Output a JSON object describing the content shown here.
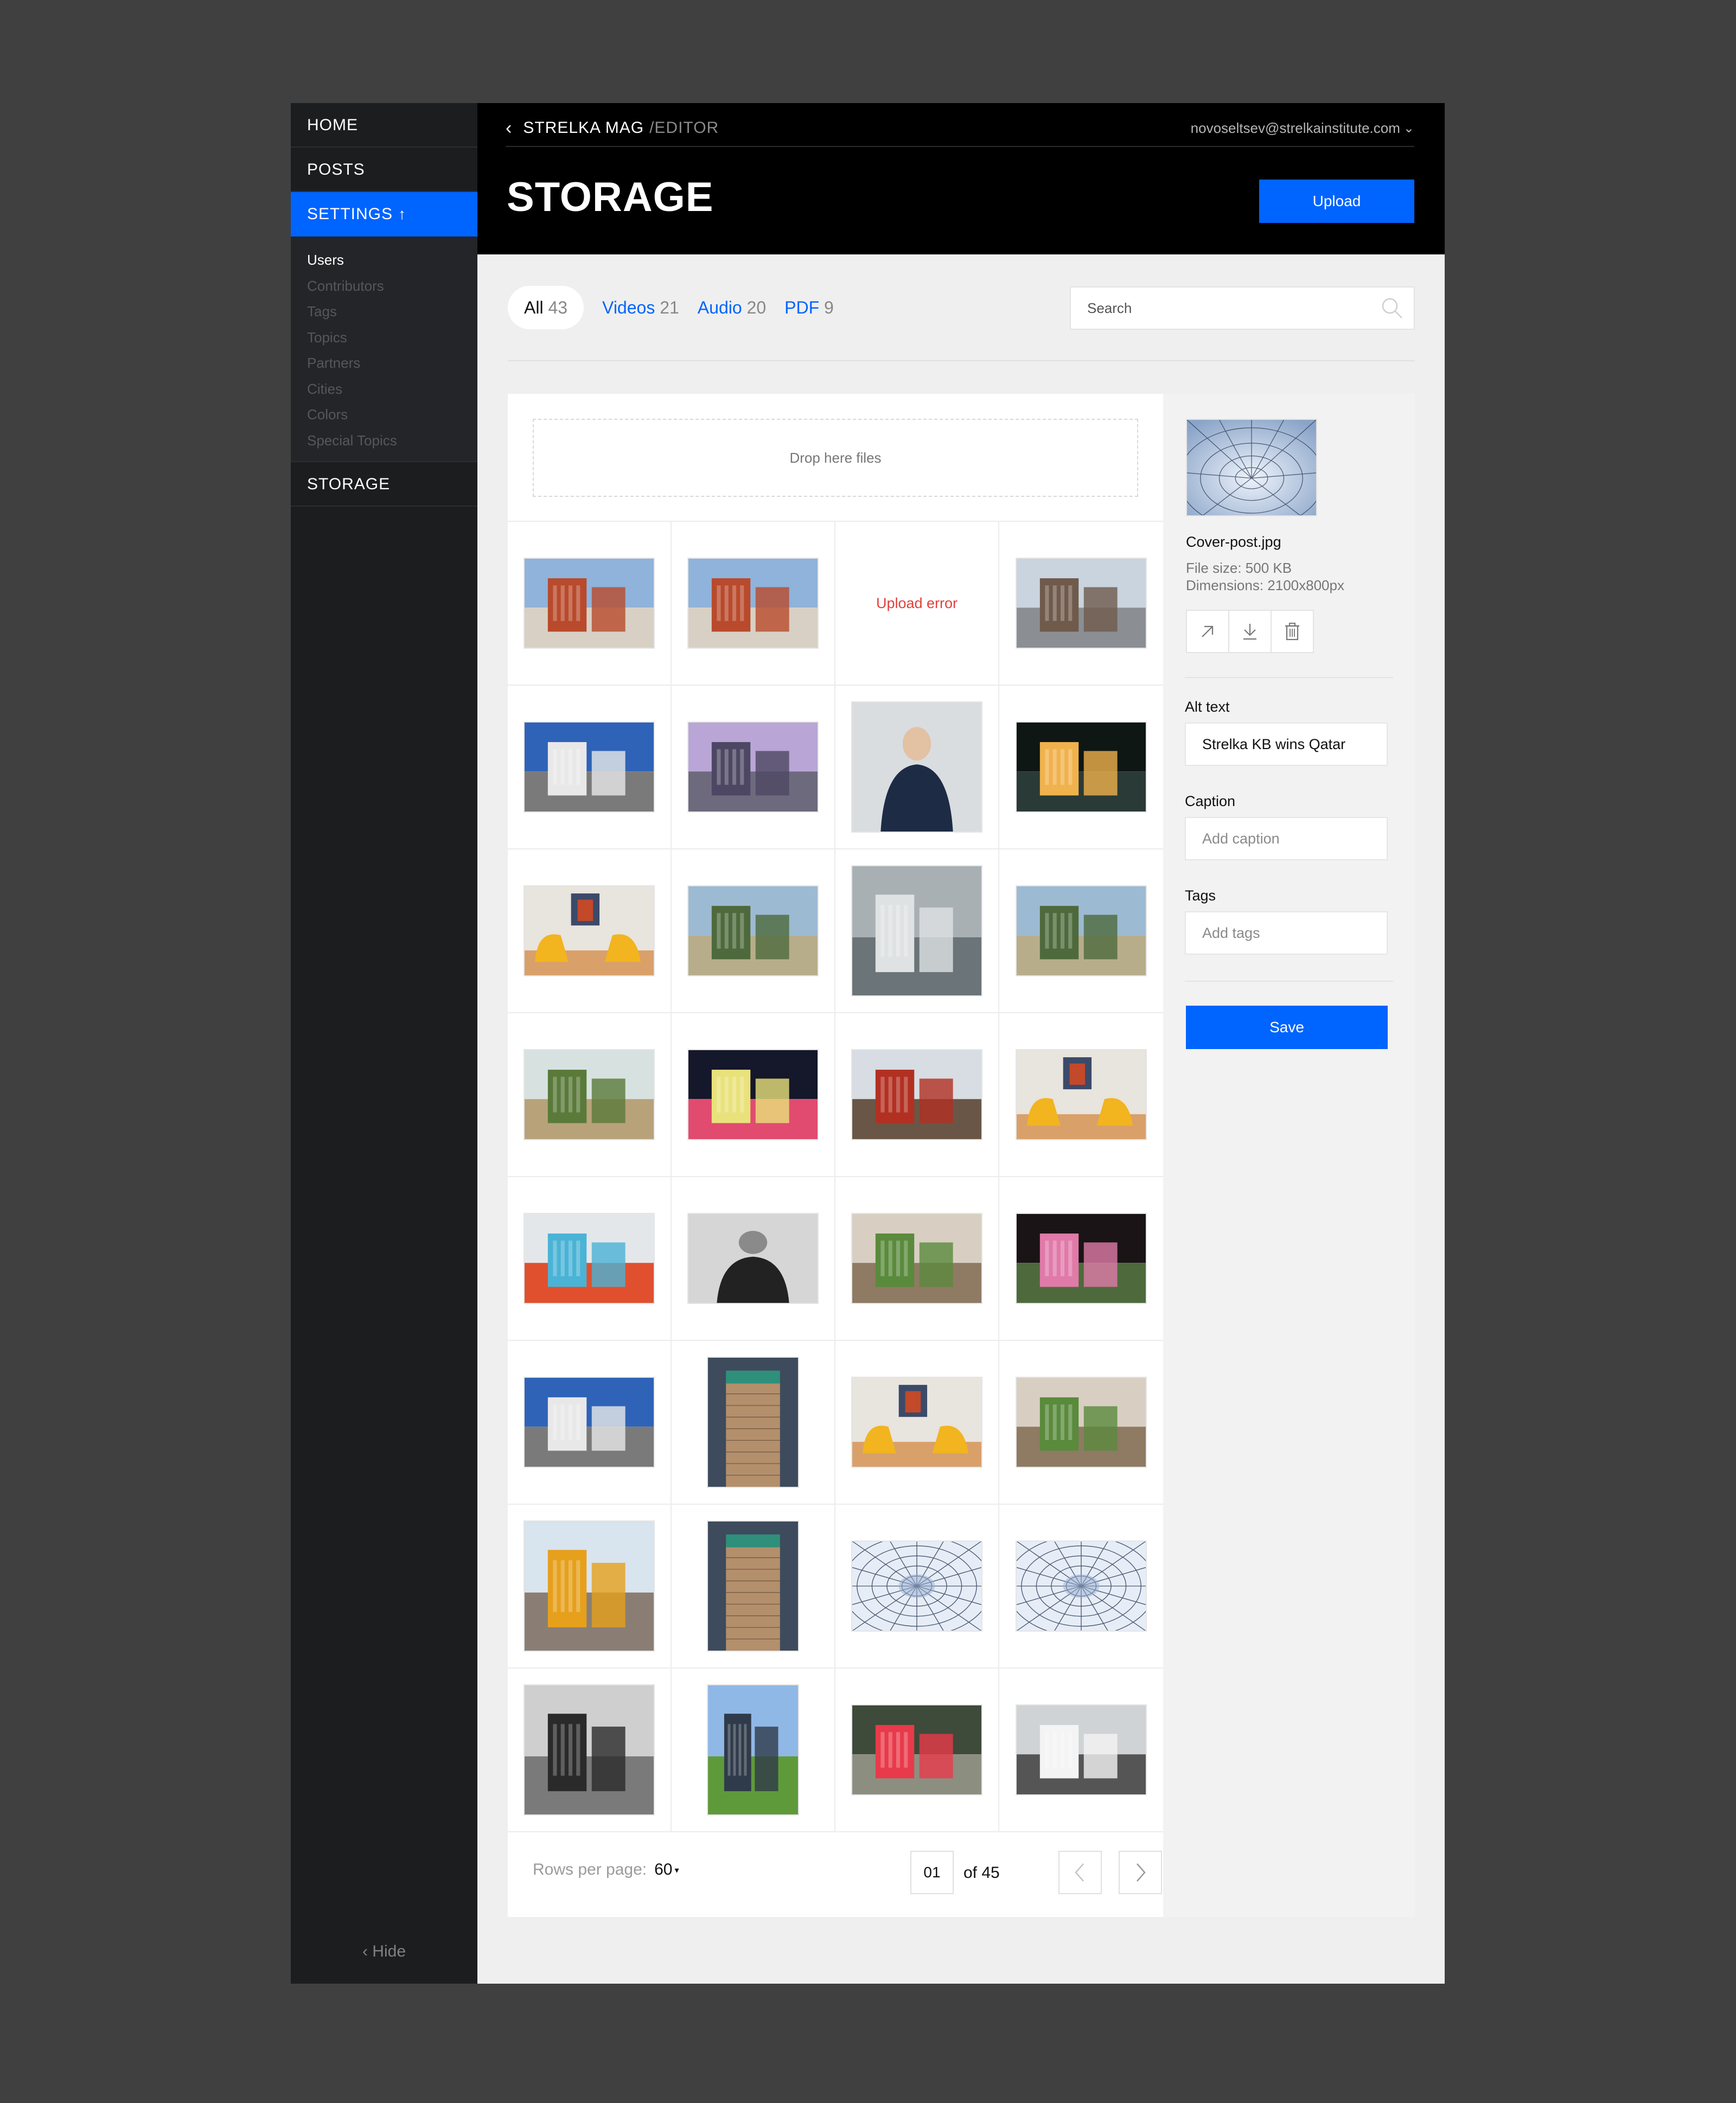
{
  "sidebar": {
    "items": [
      {
        "label": "HOME"
      },
      {
        "label": "POSTS"
      },
      {
        "label": "SETTINGS",
        "arrow": "↑"
      }
    ],
    "settings_sub": [
      "Users",
      "Contributors",
      "Tags",
      "Topics",
      "Partners",
      "Cities",
      "Colors",
      "Special Topics"
    ],
    "storage_label": "STORAGE",
    "hide_label": "‹ Hide"
  },
  "header": {
    "back_icon": "‹",
    "app_name": "STRELKA MAG",
    "section": "/EDITOR",
    "user_email": "novoseltsev@strelkainstitute.com",
    "user_chevron": "⌄",
    "title": "STORAGE",
    "upload_label": "Upload"
  },
  "filters": {
    "all": {
      "label": "All",
      "count": "43"
    },
    "videos": {
      "label": "Videos",
      "count": "21"
    },
    "audio": {
      "label": "Audio",
      "count": "20"
    },
    "pdf": {
      "label": "PDF",
      "count": "9"
    },
    "search_placeholder": "Search"
  },
  "media": {
    "dropzone_label": "Drop here files",
    "upload_error_label": "Upload error",
    "thumbnails": [
      {
        "subject": "red brick building city"
      },
      {
        "subject": "red brick building city"
      },
      {
        "subject": "upload error"
      },
      {
        "subject": "street with towers"
      },
      {
        "subject": "white water tower"
      },
      {
        "subject": "misty city skyline"
      },
      {
        "subject": "man in suit portrait"
      },
      {
        "subject": "modern house at night"
      },
      {
        "subject": "yellow chairs interior"
      },
      {
        "subject": "terraced building by river"
      },
      {
        "subject": "white tower by water"
      },
      {
        "subject": "terraced building by river"
      },
      {
        "subject": "triangular wood building"
      },
      {
        "subject": "conference stage"
      },
      {
        "subject": "red carpet installation in forest"
      },
      {
        "subject": "yellow chairs interior"
      },
      {
        "subject": "blue modular building"
      },
      {
        "subject": "couple black and white portrait"
      },
      {
        "subject": "shelf interior with plants"
      },
      {
        "subject": "dark interior with pink lights"
      },
      {
        "subject": "white water tower"
      },
      {
        "subject": "stone skyscraper"
      },
      {
        "subject": "yellow chairs interior"
      },
      {
        "subject": "shelf interior with plants"
      },
      {
        "subject": "yellow wooden canopy"
      },
      {
        "subject": "stone skyscraper"
      },
      {
        "subject": "spherical glass dome"
      },
      {
        "subject": "spherical glass dome"
      },
      {
        "subject": "black and white archive photo"
      },
      {
        "subject": "glass building with lawn steps"
      },
      {
        "subject": "aerial view with red roof"
      },
      {
        "subject": "white modernist house"
      }
    ]
  },
  "pager": {
    "rows_label": "Rows per page:",
    "rows_value": "60",
    "rows_caret": "▾",
    "page_value": "01",
    "of_label": "of 45"
  },
  "details": {
    "file_name": "Cover-post.jpg",
    "file_size": "File size: 500 KB",
    "dimensions": "Dimensions: 2100x800px",
    "alt_label": "Alt text",
    "alt_value": "Strelka KB wins Qatar",
    "caption_label": "Caption",
    "caption_placeholder": "Add caption",
    "tags_label": "Tags",
    "tags_placeholder": "Add tags",
    "save_label": "Save"
  },
  "colors": {
    "accent": "#0064ff",
    "error": "#e0403a",
    "sidebar": "#1c1d1f",
    "header": "#000000"
  }
}
